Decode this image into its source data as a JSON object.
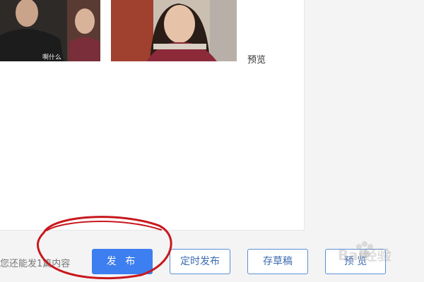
{
  "editor": {
    "thumbnails": [
      {
        "caption": "啊什么"
      },
      {
        "caption": ""
      }
    ],
    "preview_link": "预览"
  },
  "action_bar": {
    "remaining_text": "您还能发1篇内容",
    "publish_label": "发 布",
    "schedule_label": "定时发布",
    "draft_label": "存草稿",
    "preview_label": "预 览"
  },
  "watermark": {
    "text": "Bai经验"
  },
  "colors": {
    "primary": "#3d7ef0",
    "outline_border": "#5b8fd6",
    "annotation": "#c8181e",
    "background": "#f4f4f4"
  }
}
